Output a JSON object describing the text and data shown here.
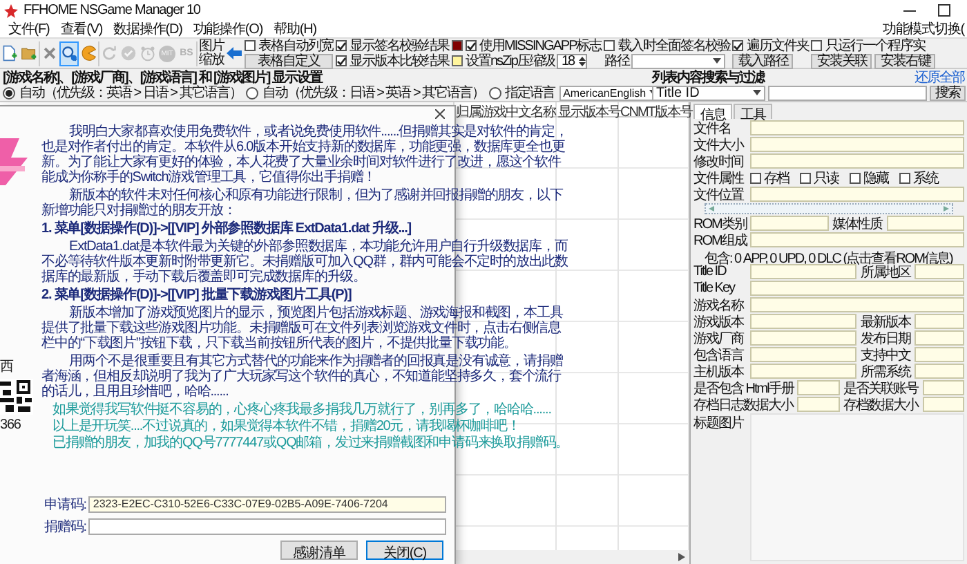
{
  "window": {
    "title": "FFHOME NSGame Manager 10"
  },
  "menu": [
    {
      "label": "文件(F)"
    },
    {
      "label": "查看(V)"
    },
    {
      "label": "数据操作(D)"
    },
    {
      "label": "功能操作(O)"
    },
    {
      "label": "帮助(H)"
    }
  ],
  "menu_right": "功能模式切换(",
  "tools": [
    {
      "selected": false,
      "disabled": false
    },
    {
      "selected": false,
      "disabled": false
    },
    {
      "selected": false,
      "disabled": false
    },
    {
      "selected": true,
      "disabled": false
    },
    {
      "selected": false,
      "disabled": false
    },
    {
      "selected": false,
      "disabled": true
    },
    {
      "selected": false,
      "disabled": true
    },
    {
      "selected": false,
      "disabled": true
    },
    {
      "selected": false,
      "disabled": true,
      "label": "MIT"
    },
    {
      "selected": false,
      "disabled": true,
      "label": "BS"
    }
  ],
  "zoom_label": "图片缩放",
  "option_columns": [
    [
      {
        "kind": "checkbox",
        "label": "表格自动列宽",
        "checked": false
      },
      {
        "kind": "button",
        "label": "表格自定义"
      }
    ],
    [
      {
        "kind": "checkbox",
        "label": "显示签名校验结果",
        "checked": true,
        "color": "#800000"
      },
      {
        "kind": "checkbox",
        "label": "显示版本比较结果",
        "checked": true,
        "color": "#fff59d"
      }
    ],
    [
      {
        "kind": "checkbox",
        "label": "使用MISSINGAPP标志",
        "checked": true
      },
      {
        "kind": "spinner",
        "label": "设置nsZip压缩级",
        "value": "18"
      }
    ],
    [
      {
        "kind": "checkbox",
        "label": "载入时全面签名校验",
        "checked": false
      },
      {
        "kind": "combo",
        "label": "路径"
      }
    ],
    [
      {
        "kind": "checkbox",
        "label": "遍历文件夹",
        "checked": true
      },
      {
        "kind": "button",
        "label": "载入路径"
      }
    ],
    [
      {
        "kind": "checkbox",
        "label": "只运行一个程序实",
        "checked": false
      },
      {
        "kind": "buttons",
        "labels": [
          "安装关联",
          "安装右键"
        ]
      }
    ]
  ],
  "display_settings": {
    "title": "[游戏名称]、[游戏厂商]、[游戏语言] 和 [游戏图片] 显示设置",
    "options": [
      {
        "label": "自动（优先级：英语 > 日语 > 其它语言）",
        "selected": true
      },
      {
        "label": "自动（优先级：日语 > 英语 > 其它语言）",
        "selected": false
      },
      {
        "label": "指定语言",
        "selected": false
      }
    ],
    "language": "AmericanEnglish"
  },
  "filter": {
    "title": "列表内容搜索与过滤",
    "link": "还原全部",
    "field": "Title ID",
    "button": "搜索"
  },
  "table": {
    "columns": [
      {
        "label": "归属游戏中文名称"
      },
      {
        "label": "显示版本号"
      },
      {
        "label": "CNMT版本号"
      }
    ]
  },
  "dialog": {
    "strip_texts": [
      "西",
      "366"
    ],
    "paragraphs": [
      {
        "kind": "body",
        "text": "我明白大家都喜欢使用免费软件，或者说免费使用软件......但捐赠其实是对软件的肯定，也是对作者付出的肯定。本软件从6.0版本开始支持新的数据库，功能更强，数据库更全也更新。为了能让大家有更好的体验，本人花费了大量业余时间对软件进行了改进，愿这个软件能成为你称手的Switch游戏管理工具，它值得你出手捐赠！"
      },
      {
        "kind": "body",
        "text": "新版本的软件未对任何核心和原有功能进行限制，但为了感谢并回报捐赠的朋友，以下新增功能只对捐赠过的朋友开放："
      },
      {
        "kind": "heading",
        "text": "1. 菜单[数据操作(D)]->[[VIP] 外部参照数据库 ExtData1.dat 升级...]"
      },
      {
        "kind": "body",
        "text": "ExtData1.dat是本软件最为关键的外部参照数据库，本功能允许用户自行升级数据库，而不必等待软件版本更新时附带更新它。未捐赠版可加入QQ群，群内可能会不定时的放出此数据库的最新版，手动下载后覆盖即可完成数据库的升级。"
      },
      {
        "kind": "heading",
        "text": "2. 菜单[数据操作(D)]->[[VIP] 批量下载游戏图片工具(P)]"
      },
      {
        "kind": "body",
        "text": "新版本增加了游戏预览图片的显示，预览图片包括游戏标题、游戏海报和截图，本工具提供了批量下载这些游戏图片功能。未捐赠版可在文件列表浏览游戏文件时，点击右侧信息栏中的“下载图片”按钮下载，只下载当前按钮所代表的图片，不提供批量下载功能。"
      },
      {
        "kind": "body",
        "text": "用两个不是很重要且有其它方式替代的功能来作为捐赠者的回报真是没有诚意，请捐赠者海涵，但相反却说明了我为了广大玩家写这个软件的真心，不知道能坚持多久，套个流行的话儿，且用且珍惜吧，哈哈......"
      },
      {
        "kind": "note",
        "text": "如果觉得我写软件挺不容易的，心疼心疼我最多捐我几万就行了，别再多了，哈哈哈......"
      },
      {
        "kind": "note",
        "text": "以上是开玩笑....不过说真的，如果觉得本软件不错，捐赠20元，请我喝杯咖啡吧！"
      },
      {
        "kind": "note",
        "text": "已捐赠的朋友，加我的QQ号7777447或QQ邮箱，发过来捐赠截图和申请码来换取捐赠码。"
      }
    ],
    "fields": [
      {
        "label": "申请码:",
        "value": "2323-E2EC-C310-52E6-C33C-07E9-02B5-A09E-7406-7204",
        "readonly": true
      },
      {
        "label": "捐赠码:",
        "readonly": false
      }
    ],
    "buttons": [
      {
        "label": "感谢清单",
        "default": false
      },
      {
        "label": "关闭(C)",
        "default": true
      }
    ]
  },
  "info_panel": {
    "tabs": [
      {
        "label": "信息",
        "selected": true
      },
      {
        "label": "工具",
        "selected": false
      }
    ],
    "rows": [
      {
        "kind": "field",
        "label": "文件名"
      },
      {
        "kind": "field",
        "label": "文件大小"
      },
      {
        "kind": "field",
        "label": "修改时间"
      },
      {
        "kind": "attributes",
        "label": "文件属性",
        "checks": [
          {
            "label": "存档",
            "checked": false
          },
          {
            "label": "只读",
            "checked": false
          },
          {
            "label": "隐藏",
            "checked": false
          },
          {
            "label": "系统",
            "checked": false
          }
        ]
      },
      {
        "kind": "field",
        "label": "文件位置"
      },
      {
        "kind": "splitter"
      },
      {
        "kind": "pair_even",
        "label": "ROM类别",
        "label2": "媒体性质"
      },
      {
        "kind": "field",
        "label": "ROM组成"
      },
      {
        "kind": "note",
        "text": "包含: 0 APP, 0 UPD, 0 DLC (点击查看ROM信息)"
      },
      {
        "kind": "pair",
        "label": "Title ID",
        "label2": "所属地区"
      },
      {
        "kind": "field",
        "label": "Title Key"
      },
      {
        "kind": "field",
        "label": "游戏名称"
      },
      {
        "kind": "pair",
        "label": "游戏版本",
        "label2": "最新版本"
      },
      {
        "kind": "pair",
        "label": "游戏厂商",
        "label2": "发布日期"
      },
      {
        "kind": "pair",
        "label": "包含语言",
        "label2": "支持中文"
      },
      {
        "kind": "pair",
        "label": "主机版本",
        "label2": "所需系统"
      },
      {
        "kind": "pair_even",
        "label": "是否包含 Html手册",
        "label2": "是否关联账号"
      },
      {
        "kind": "pair_even",
        "label": "存档日志数据大小",
        "label2": "存档数据大小"
      },
      {
        "kind": "picture",
        "label": "标题图片"
      }
    ]
  }
}
